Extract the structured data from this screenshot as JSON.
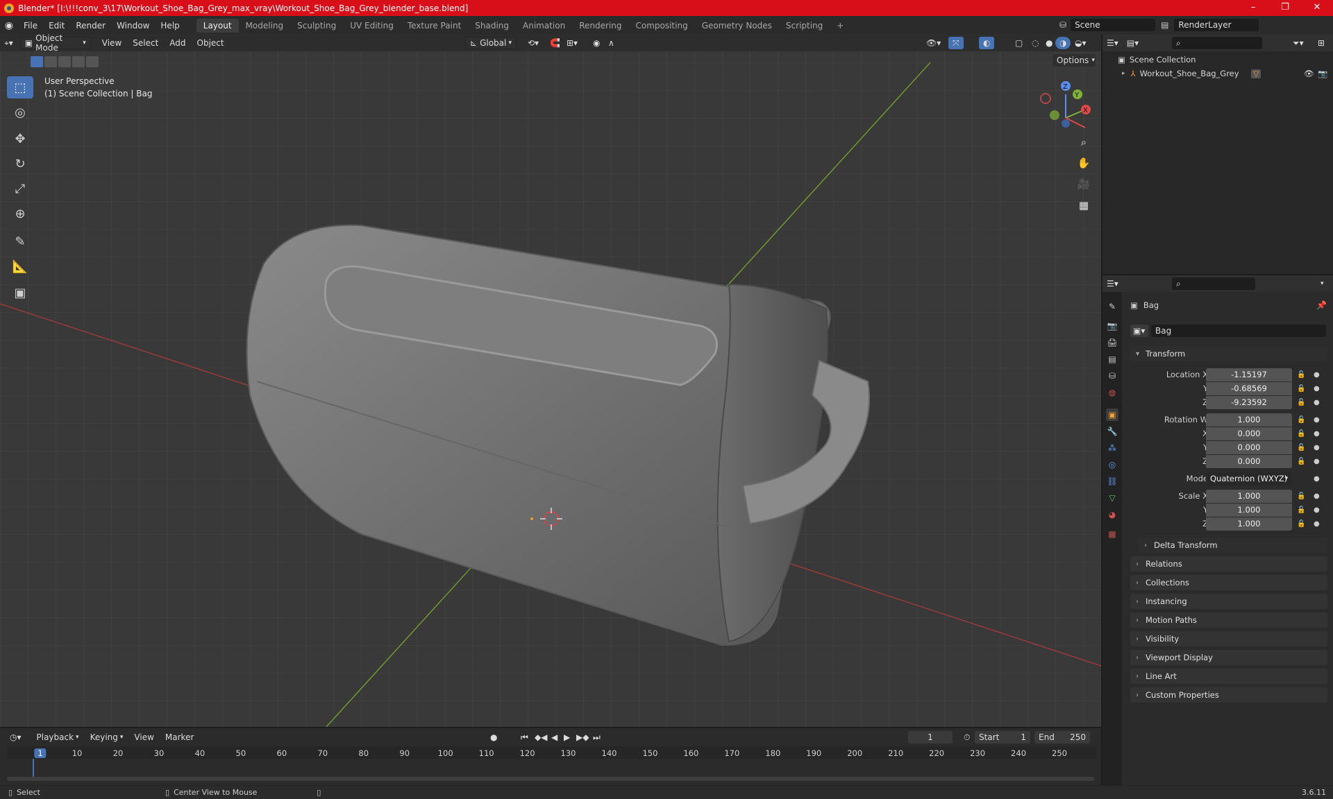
{
  "window": {
    "title": "Blender* [I:\\!!!conv_3\\17\\Workout_Shoe_Bag_Grey_max_vray\\Workout_Shoe_Bag_Grey_blender_base.blend]",
    "minimize": "–",
    "maximize": "❐",
    "close": "✕"
  },
  "menu": [
    "File",
    "Edit",
    "Render",
    "Window",
    "Help"
  ],
  "workspaces": [
    "Layout",
    "Modeling",
    "Sculpting",
    "UV Editing",
    "Texture Paint",
    "Shading",
    "Animation",
    "Rendering",
    "Compositing",
    "Geometry Nodes",
    "Scripting"
  ],
  "active_workspace": "Layout",
  "add_workspace": "+",
  "scene": {
    "name": "Scene",
    "view_layer": "RenderLayer"
  },
  "viewport": {
    "mode": "Object Mode",
    "menus": [
      "View",
      "Select",
      "Add",
      "Object"
    ],
    "transform_orientation": "Global",
    "options": "Options",
    "overlay_title": "User Perspective",
    "overlay_subtitle": "(1) Scene Collection | Bag",
    "gizmo": {
      "x": "X",
      "y": "Y",
      "z": "Z"
    }
  },
  "outliner": {
    "root": "Scene Collection",
    "items": [
      {
        "label": "Workout_Shoe_Bag_Grey"
      }
    ]
  },
  "properties": {
    "object_name": "Bag",
    "data_name": "Bag",
    "transform_title": "Transform",
    "location": {
      "label": "Location X",
      "x": "-1.15197",
      "y": "-0.68569",
      "z": "-9.23592"
    },
    "rotation": {
      "label": "Rotation W",
      "w": "1.000",
      "x": "0.000",
      "y": "0.000",
      "z": "0.000"
    },
    "mode": {
      "label": "Mode",
      "value": "Quaternion (WXYZ)"
    },
    "scale": {
      "label": "Scale X",
      "x": "1.000",
      "y": "1.000",
      "z": "1.000"
    },
    "axis_y": "Y",
    "axis_z": "Z",
    "axis_x": "X",
    "delta": "Delta Transform",
    "panels": [
      "Relations",
      "Collections",
      "Instancing",
      "Motion Paths",
      "Visibility",
      "Viewport Display",
      "Line Art",
      "Custom Properties"
    ]
  },
  "timeline": {
    "menus": [
      "Playback",
      "Keying",
      "View",
      "Marker"
    ],
    "current_frame": "1",
    "start_label": "Start",
    "start": "1",
    "end_label": "End",
    "end": "250",
    "ticks": [
      "1",
      "10",
      "20",
      "30",
      "40",
      "50",
      "60",
      "70",
      "80",
      "90",
      "100",
      "110",
      "120",
      "130",
      "140",
      "150",
      "160",
      "170",
      "180",
      "190",
      "200",
      "210",
      "220",
      "230",
      "240",
      "250"
    ]
  },
  "status": {
    "select": "Select",
    "center": "Center View to Mouse",
    "version": "3.6.11"
  },
  "colors": {
    "title_bar": "#d80f18",
    "accent": "#4772b3",
    "viewport_bg": "#393939"
  }
}
